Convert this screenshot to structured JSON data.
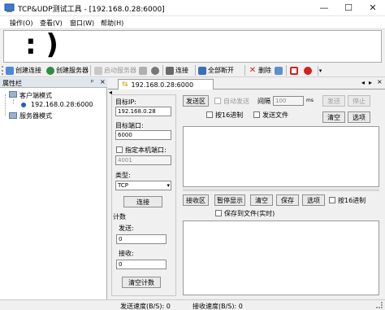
{
  "window": {
    "title": "TCP&UDP测试工具 - [192.168.0.28:6000]",
    "minimize_glyph": "—",
    "maximize_glyph": "☐",
    "close_glyph": "✕"
  },
  "menu": [
    "操作(O)",
    "查看(V)",
    "窗口(W)",
    "帮助(H)"
  ],
  "banner": {
    "emoticon": ": )"
  },
  "toolbar": {
    "create_connection": "创建连接",
    "create_server": "创建服务器",
    "start_server": "启动服务器",
    "connect": "连接",
    "disconnect_all": "全部断开",
    "delete": "删除"
  },
  "sidebar": {
    "title": "属性栏",
    "pin_glyph": "ᵖ",
    "close_glyph": "×",
    "client_mode": "客户端模式",
    "client_item": "192.168.0.28:6000",
    "server_mode": "服务器模式"
  },
  "tab": {
    "label": "192.168.0.28:6000"
  },
  "tab_nav": {
    "prev": "◂",
    "next": "▸",
    "close": "×",
    "left_arrow": "◂"
  },
  "settings": {
    "target_ip_label": "目标IP:",
    "target_ip": "192.168.0.28",
    "target_port_label": "目标端口:",
    "target_port": "6000",
    "local_port_label": "指定本机端口:",
    "local_port": "4001",
    "type_label": "类型:",
    "type_value": "TCP",
    "connect_button": "连接",
    "count_label": "计数",
    "send_label": "发送:",
    "send_count": "0",
    "recv_label": "接收:",
    "recv_count": "0",
    "clear_count_button": "清空计数"
  },
  "send_area": {
    "send_area_button": "发送区",
    "auto_send": "自动发送",
    "interval_label": "间隔",
    "interval_value": "100",
    "interval_unit": "ms",
    "send_button": "发送",
    "stop_button": "停止",
    "hex_send": "按16进制",
    "send_file": "发送文件",
    "clear_button": "清空",
    "options_button": "选项"
  },
  "recv_area": {
    "recv_area_button": "接收区",
    "pause_display": "暂停显示",
    "clear_button": "清空",
    "save_button": "保存",
    "options_button": "选项",
    "hex_recv": "按16进制",
    "save_to_file": "保存到文件(实时)"
  },
  "status": {
    "send_speed": "发送速度(B/S): 0",
    "recv_speed": "接收速度(B/S): 0"
  },
  "colors": {
    "accent": "#1f5fbf",
    "stop_red": "#d42020",
    "tab_header": "#dfe6ee"
  }
}
